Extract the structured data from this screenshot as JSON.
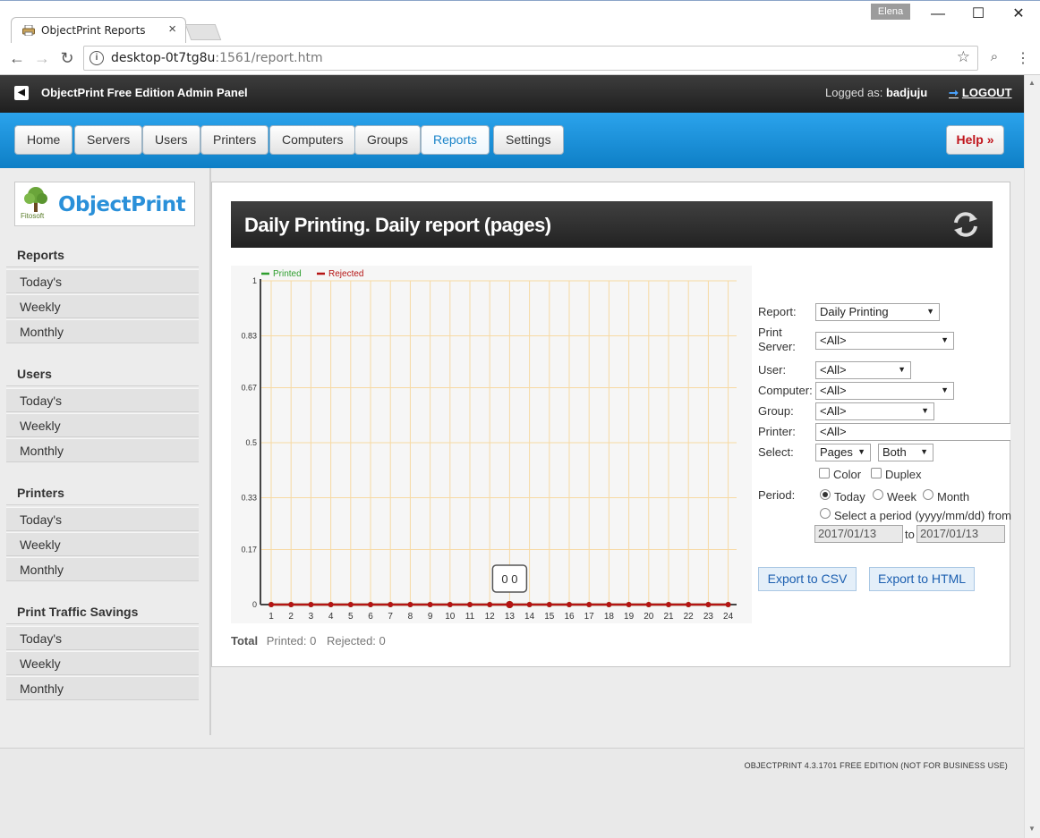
{
  "browser": {
    "tab_title": "ObjectPrint Reports",
    "user_badge": "Elena",
    "url_host": "desktop-0t7tg8u",
    "url_rest": ":1561/report.htm"
  },
  "header": {
    "panel_title": "ObjectPrint Free Edition Admin Panel",
    "logged_label": "Logged as:",
    "user": "badjuju",
    "logout": "LOGOUT"
  },
  "nav": {
    "items": [
      {
        "label": "Home"
      },
      {
        "label": "Servers"
      },
      {
        "label": "Users"
      },
      {
        "label": "Printers"
      },
      {
        "label": "Computers"
      },
      {
        "label": "Groups"
      },
      {
        "label": "Reports"
      },
      {
        "label": "Settings"
      }
    ],
    "help": "Help »",
    "active": "Reports"
  },
  "sidebar": {
    "logo_text": "ObjectPrint",
    "logo_sub": "Fitosoft",
    "sections": [
      {
        "title": "Reports",
        "items": [
          "Today's",
          "Weekly",
          "Monthly"
        ]
      },
      {
        "title": "Users",
        "items": [
          "Today's",
          "Weekly",
          "Monthly"
        ]
      },
      {
        "title": "Printers",
        "items": [
          "Today's",
          "Weekly",
          "Monthly"
        ]
      },
      {
        "title": "Print Traffic Savings",
        "items": [
          "Today's",
          "Weekly",
          "Monthly"
        ]
      }
    ]
  },
  "report": {
    "title": "Daily Printing. Daily report (pages)",
    "total_label": "Total",
    "total_printed": "Printed: 0",
    "total_rejected": "Rejected: 0",
    "tooltip": "0 0"
  },
  "form": {
    "report_label": "Report:",
    "report_value": "Daily Printing",
    "server_label_1": "Print",
    "server_label_2": "Server:",
    "server_value": "<All>",
    "user_label": "User:",
    "user_value": "<All>",
    "computer_label": "Computer:",
    "computer_value": "<All>",
    "group_label": "Group:",
    "group_value": "<All>",
    "printer_label": "Printer:",
    "printer_value": "<All>",
    "select_label": "Select:",
    "select_value": "Pages",
    "select2_value": "Both",
    "color_label": "Color",
    "duplex_label": "Duplex",
    "period_label": "Period:",
    "period_today": "Today",
    "period_week": "Week",
    "period_month": "Month",
    "period_custom": "Select a period (yyyy/mm/dd) from",
    "date_from": "2017/01/13",
    "date_to_label": "to",
    "date_to": "2017/01/13",
    "export_csv": "Export to CSV",
    "export_html": "Export to HTML"
  },
  "footer": {
    "text": "OBJECTPRINT 4.3.1701  FREE EDITION (NOT FOR BUSINESS USE)"
  },
  "colors": {
    "printed": "#2e9e2e",
    "rejected": "#b51414",
    "grid": "#f7d9a3",
    "nav_blue": "#1a95e0"
  },
  "chart_data": {
    "type": "line",
    "x": [
      1,
      2,
      3,
      4,
      5,
      6,
      7,
      8,
      9,
      10,
      11,
      12,
      13,
      14,
      15,
      16,
      17,
      18,
      19,
      20,
      21,
      22,
      23,
      24
    ],
    "ylim": [
      0,
      1
    ],
    "yticks": [
      "0",
      "0.17",
      "0.33",
      "0.5",
      "0.67",
      "0.83",
      "1"
    ],
    "series": [
      {
        "name": "Printed",
        "values": [
          0,
          0,
          0,
          0,
          0,
          0,
          0,
          0,
          0,
          0,
          0,
          0,
          0,
          0,
          0,
          0,
          0,
          0,
          0,
          0,
          0,
          0,
          0,
          0
        ]
      },
      {
        "name": "Rejected",
        "values": [
          0,
          0,
          0,
          0,
          0,
          0,
          0,
          0,
          0,
          0,
          0,
          0,
          0,
          0,
          0,
          0,
          0,
          0,
          0,
          0,
          0,
          0,
          0,
          0
        ]
      }
    ],
    "legend": "top-left",
    "grid": true
  }
}
